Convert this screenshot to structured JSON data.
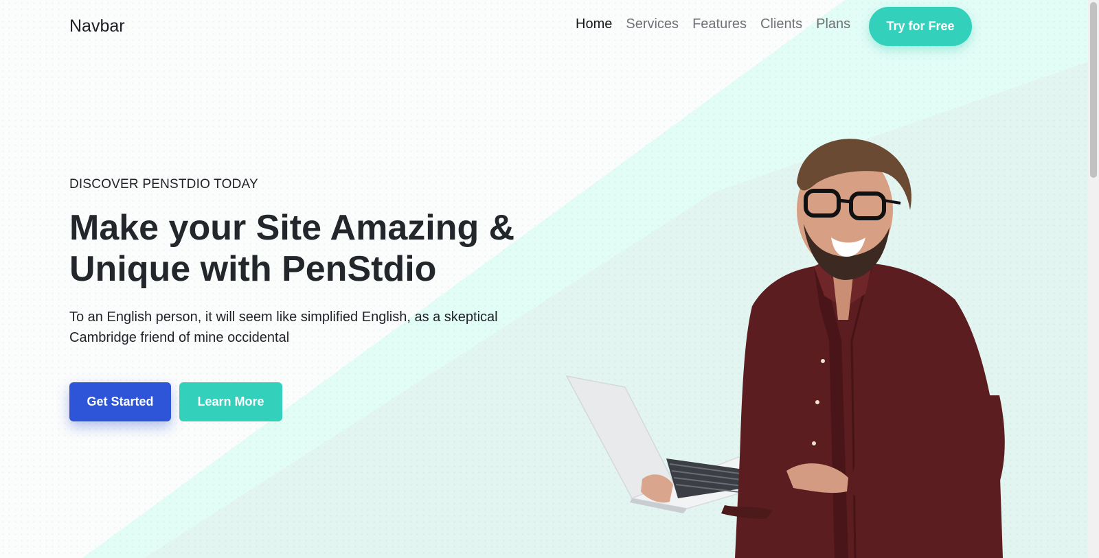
{
  "navbar": {
    "brand": "Navbar",
    "links": [
      {
        "label": "Home",
        "active": true
      },
      {
        "label": "Services",
        "active": false
      },
      {
        "label": "Features",
        "active": false
      },
      {
        "label": "Clients",
        "active": false
      },
      {
        "label": "Plans",
        "active": false
      }
    ],
    "cta_label": "Try for Free"
  },
  "hero": {
    "eyebrow": "DISCOVER PENSTDIO TODAY",
    "headline_line1": "Make your Site Amazing &",
    "headline_line2": "Unique with PenStdio",
    "subtext_line1": "To an English person, it will seem like simplified English, as a skeptical",
    "subtext_line2": "Cambridge friend of mine occidental",
    "primary_button": "Get Started",
    "secondary_button": "Learn More"
  },
  "colors": {
    "accent_teal": "#33d1bb",
    "primary_blue": "#2e55d8",
    "text_dark": "#23262b"
  },
  "icons": {
    "hero_image": "man-with-laptop-illustration"
  }
}
